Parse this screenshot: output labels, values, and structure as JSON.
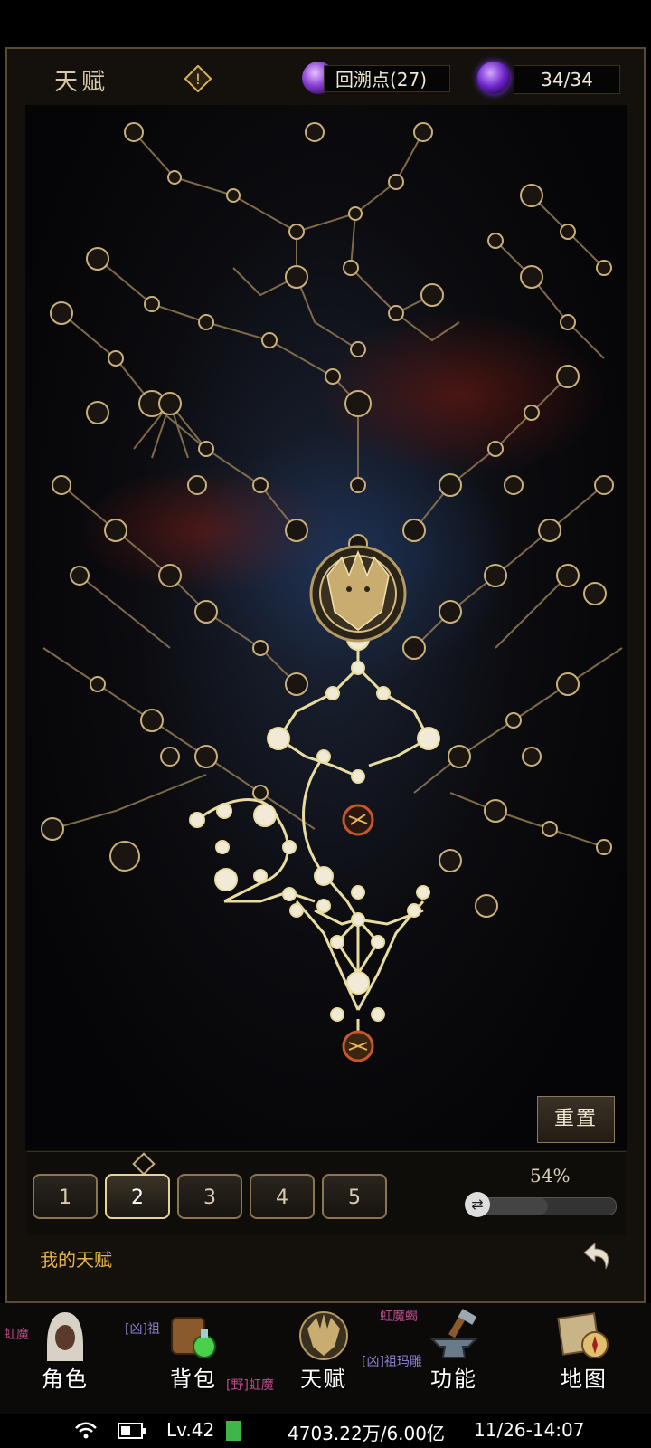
{
  "header": {
    "title": "天赋",
    "warning_icon": "warning-diamond-icon",
    "points_label": "回溯点(27)",
    "energy_label": "34/34"
  },
  "tree": {
    "center_icon": "dragon-emblem-icon",
    "accent_color": "#d8c08a",
    "active_color": "#f2e6b0"
  },
  "reset_label": "重置",
  "slots": [
    "1",
    "2",
    "3",
    "4",
    "5"
  ],
  "active_slot": "2",
  "progress": {
    "percent_text": "54%",
    "value": 54
  },
  "footer": {
    "label": "我的天赋"
  },
  "nav": [
    {
      "label": "角色",
      "icon": "hooded-character-icon"
    },
    {
      "label": "背包",
      "icon": "backpack-potion-icon"
    },
    {
      "label": "天赋",
      "icon": "dragon-emblem-icon"
    },
    {
      "label": "功能",
      "icon": "anvil-hammer-icon"
    },
    {
      "label": "地图",
      "icon": "map-compass-icon"
    }
  ],
  "chat": {
    "line1": "[凶]祖",
    "line2": "[野]虹魔",
    "line3": "[凶]祖玛雕",
    "line4": "虹魔蝎",
    "line5": "虹魔"
  },
  "status": {
    "level": "Lv.42",
    "gold": "4703.22万/6.00亿",
    "datetime": "11/26-14:07"
  }
}
